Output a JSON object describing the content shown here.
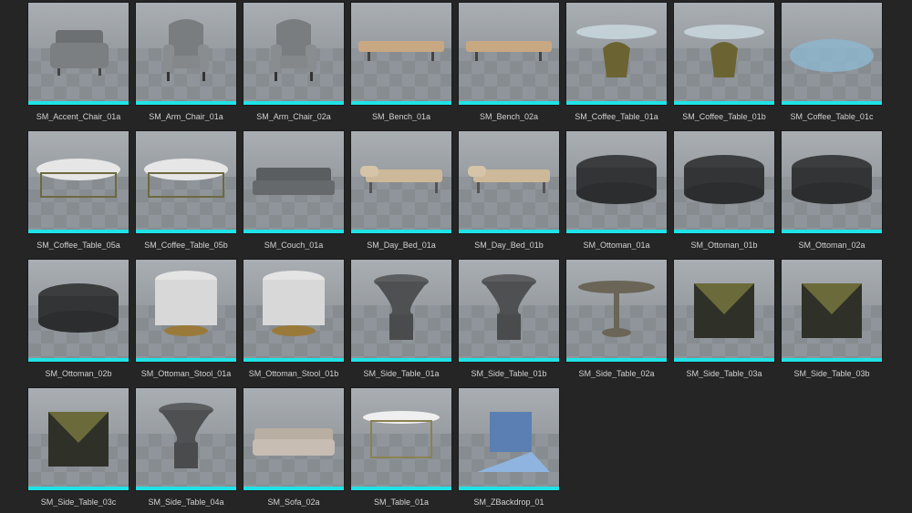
{
  "assets": [
    {
      "label": "SM_Accent_Chair_01a",
      "icon": "accent-chair-icon"
    },
    {
      "label": "SM_Arm_Chair_01a",
      "icon": "arm-chair-icon"
    },
    {
      "label": "SM_Arm_Chair_02a",
      "icon": "arm-chair-icon"
    },
    {
      "label": "SM_Bench_01a",
      "icon": "bench-icon"
    },
    {
      "label": "SM_Bench_02a",
      "icon": "bench-icon"
    },
    {
      "label": "SM_Coffee_Table_01a",
      "icon": "coffee-table-icon"
    },
    {
      "label": "SM_Coffee_Table_01b",
      "icon": "coffee-table-icon"
    },
    {
      "label": "SM_Coffee_Table_01c",
      "icon": "glass-table-top-icon"
    },
    {
      "label": "SM_Coffee_Table_05a",
      "icon": "round-coffee-table-icon"
    },
    {
      "label": "SM_Coffee_Table_05b",
      "icon": "round-coffee-table-icon"
    },
    {
      "label": "SM_Couch_01a",
      "icon": "couch-icon"
    },
    {
      "label": "SM_Day_Bed_01a",
      "icon": "day-bed-icon"
    },
    {
      "label": "SM_Day_Bed_01b",
      "icon": "day-bed-icon"
    },
    {
      "label": "SM_Ottoman_01a",
      "icon": "ottoman-icon"
    },
    {
      "label": "SM_Ottoman_01b",
      "icon": "ottoman-icon"
    },
    {
      "label": "SM_Ottoman_02a",
      "icon": "ottoman-icon"
    },
    {
      "label": "SM_Ottoman_02b",
      "icon": "ottoman-icon"
    },
    {
      "label": "SM_Ottoman_Stool_01a",
      "icon": "ottoman-stool-icon"
    },
    {
      "label": "SM_Ottoman_Stool_01b",
      "icon": "ottoman-stool-icon"
    },
    {
      "label": "SM_Side_Table_01a",
      "icon": "side-table-icon"
    },
    {
      "label": "SM_Side_Table_01b",
      "icon": "side-table-icon"
    },
    {
      "label": "SM_Side_Table_02a",
      "icon": "pedestal-table-icon"
    },
    {
      "label": "SM_Side_Table_03a",
      "icon": "cube-table-icon"
    },
    {
      "label": "SM_Side_Table_03b",
      "icon": "cube-table-icon"
    },
    {
      "label": "SM_Side_Table_03c",
      "icon": "cube-table-icon"
    },
    {
      "label": "SM_Side_Table_04a",
      "icon": "side-table-icon"
    },
    {
      "label": "SM_Sofa_02a",
      "icon": "sofa-icon"
    },
    {
      "label": "SM_Table_01a",
      "icon": "table-icon"
    },
    {
      "label": "SM_ZBackdrop_01",
      "icon": "backdrop-icon"
    }
  ],
  "accent_color": "#1fe2e6"
}
